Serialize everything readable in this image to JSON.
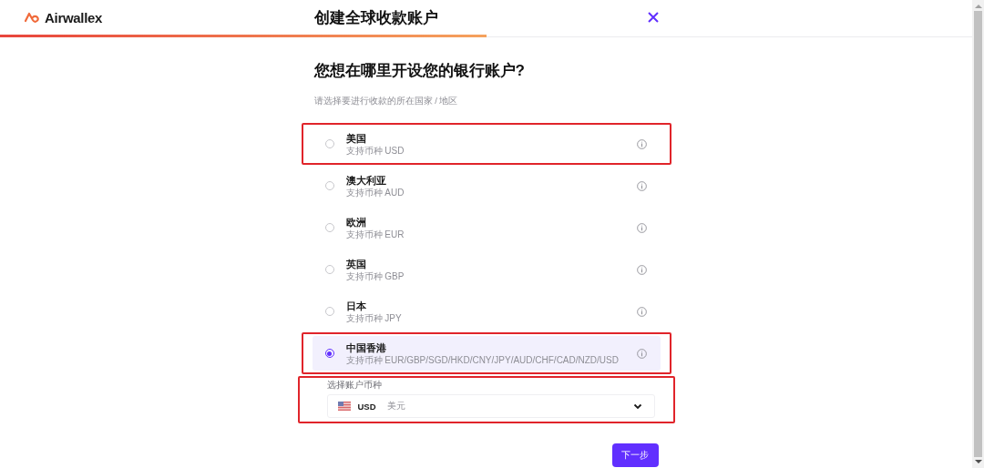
{
  "header": {
    "brand": "Airwallex",
    "title": "创建全球收款账户",
    "progress": {
      "level": 0.5
    }
  },
  "question": "您想在哪里开设您的银行账户?",
  "hint": "请选择要进行收款的所在国家 / 地区",
  "options": [
    {
      "name": "美国",
      "currencies": "支持币种 USD",
      "selected": false,
      "highlighted": true
    },
    {
      "name": "澳大利亚",
      "currencies": "支持币种 AUD",
      "selected": false,
      "highlighted": false
    },
    {
      "name": "欧洲",
      "currencies": "支持币种 EUR",
      "selected": false,
      "highlighted": false
    },
    {
      "name": "英国",
      "currencies": "支持币种 GBP",
      "selected": false,
      "highlighted": false
    },
    {
      "name": "日本",
      "currencies": "支持币种 JPY",
      "selected": false,
      "highlighted": false
    },
    {
      "name": "中国香港",
      "currencies": "支持币种 EUR/GBP/SGD/HKD/CNY/JPY/AUD/CHF/CAD/NZD/USD",
      "selected": true,
      "highlighted": true
    }
  ],
  "currency_select": {
    "label": "选择账户币种",
    "code": "USD",
    "name": "美元",
    "highlighted": true
  },
  "next_button": "下一步"
}
